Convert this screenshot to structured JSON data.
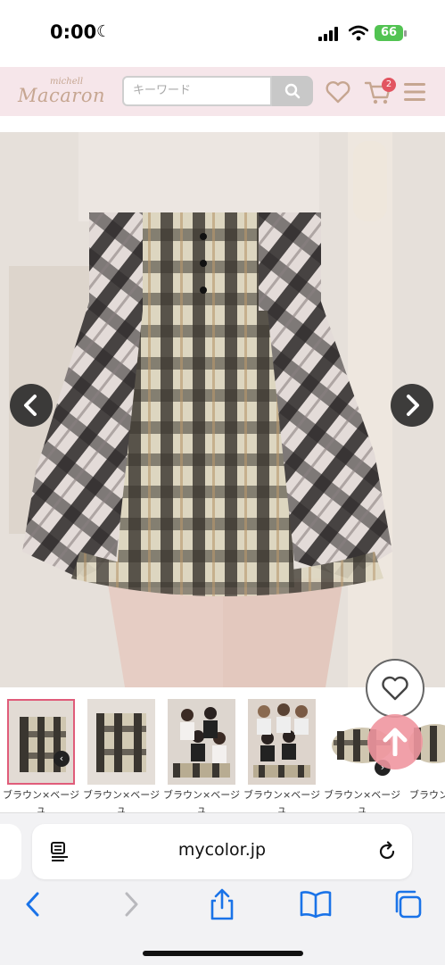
{
  "status_bar": {
    "time": "0:00",
    "battery": "66"
  },
  "header": {
    "logo_top": "michell",
    "logo_main": "Macaron",
    "search_placeholder": "キーワード",
    "cart_count": "2"
  },
  "thumbnails": [
    {
      "caption": "ブラウン×ベージュ",
      "selected": true
    },
    {
      "caption": "ブラウン×ベージュ",
      "selected": false
    },
    {
      "caption": "ブラウン×ベージュ",
      "selected": false
    },
    {
      "caption": "ブラウン×ベージュ",
      "selected": false
    },
    {
      "caption": "ブラウン×ベージュ",
      "selected": false
    },
    {
      "caption": "ブラウン×ベ",
      "selected": false
    }
  ],
  "browser": {
    "url": "mycolor.jp"
  },
  "colors": {
    "header_bg": "#f6e6ea",
    "logo": "#c6a691",
    "accent_pink": "#e05c7a",
    "battery": "#52c352"
  },
  "icons": [
    "moon-icon",
    "signal-icon",
    "wifi-icon",
    "search-icon",
    "heart-icon",
    "cart-icon",
    "menu-icon",
    "chevron-left-icon",
    "chevron-right-icon",
    "arrow-up-icon",
    "reader-icon",
    "reload-icon",
    "back-icon",
    "forward-icon",
    "share-icon",
    "bookmarks-icon",
    "tabs-icon"
  ]
}
